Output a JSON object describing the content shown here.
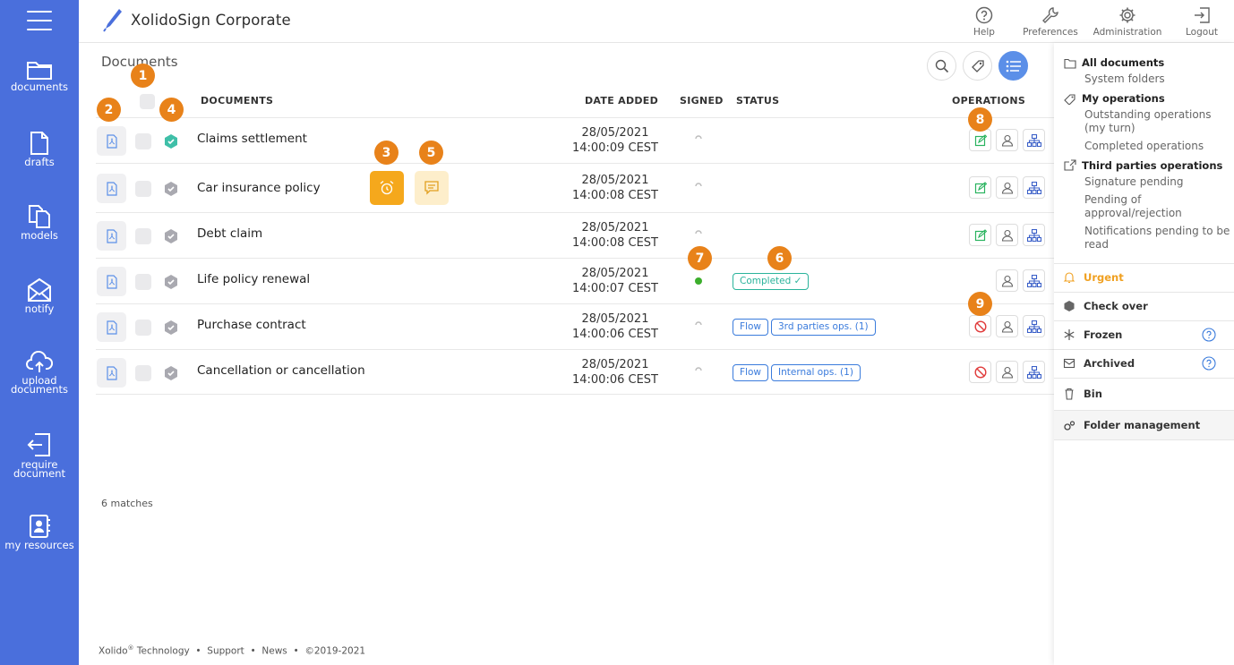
{
  "app": {
    "title": "XolidoSign Corporate"
  },
  "nav": {
    "items": [
      {
        "label": "documents",
        "icon": "folder-icon"
      },
      {
        "label": "drafts",
        "icon": "file-icon"
      },
      {
        "label": "models",
        "icon": "copy-icon"
      },
      {
        "label": "notify",
        "icon": "envelope-icon"
      },
      {
        "label": "upload\ndocuments",
        "icon": "cloud-upload-icon"
      },
      {
        "label": "require\ndocument",
        "icon": "sign-in-icon"
      },
      {
        "label": "my resources",
        "icon": "contact-book-icon"
      }
    ]
  },
  "header": {
    "help": "Help",
    "preferences": "Preferences",
    "administration": "Administration",
    "logout": "Logout"
  },
  "main": {
    "title": "Documents",
    "columns": {
      "documents": "DOCUMENTS",
      "date_added": "DATE ADDED",
      "signed": "SIGNED",
      "status": "STATUS",
      "operations": "OPERATIONS"
    },
    "rows": [
      {
        "name": "Claims settlement",
        "date": "28/05/2021",
        "time": "14:00:09 CEST",
        "signed": false,
        "badges": []
      },
      {
        "name": "Car insurance policy",
        "date": "28/05/2021",
        "time": "14:00:08 CEST",
        "signed": false,
        "badges": []
      },
      {
        "name": "Debt claim",
        "date": "28/05/2021",
        "time": "14:00:08 CEST",
        "signed": false,
        "badges": []
      },
      {
        "name": "Life policy renewal",
        "date": "28/05/2021",
        "time": "14:00:07 CEST",
        "signed": true,
        "badges": [
          "Completed"
        ]
      },
      {
        "name": "Purchase contract",
        "date": "28/05/2021",
        "time": "14:00:06 CEST",
        "signed": false,
        "badges": [
          "Flow",
          "3rd parties ops. (1)"
        ]
      },
      {
        "name": "Cancellation or cancellation",
        "date": "28/05/2021",
        "time": "14:00:06 CEST",
        "signed": false,
        "badges": [
          "Flow",
          "Internal ops. (1)"
        ]
      }
    ],
    "matches": "6 matches",
    "callouts": [
      "1",
      "2",
      "3",
      "4",
      "5",
      "6",
      "7",
      "8",
      "9"
    ]
  },
  "footer": {
    "brand": "Xolido",
    "reg": "®",
    "brand_rest": " Technology",
    "sep": "•",
    "support": "Support",
    "news": "News",
    "copyright": "©2019-2021"
  },
  "panel": {
    "all_documents": "All documents",
    "system_folders": "System folders",
    "my_operations": "My operations",
    "outstanding": "Outstanding operations (my turn)",
    "completed_ops": "Completed operations",
    "third_parties": "Third parties operations",
    "signature_pending": "Signature pending",
    "pending_approval": "Pending of approval/rejection",
    "notifications_pending": "Notifications pending to be read",
    "urgent": "Urgent",
    "check_over": "Check over",
    "frozen": "Frozen",
    "archived": "Archived",
    "bin": "Bin",
    "folder_management": "Folder management"
  },
  "colors": {
    "nav": "#4a6fdc",
    "accent": "#e8821a",
    "urgent": "#f0a020",
    "blue": "#3a7bdc",
    "green": "#2ab39b"
  }
}
